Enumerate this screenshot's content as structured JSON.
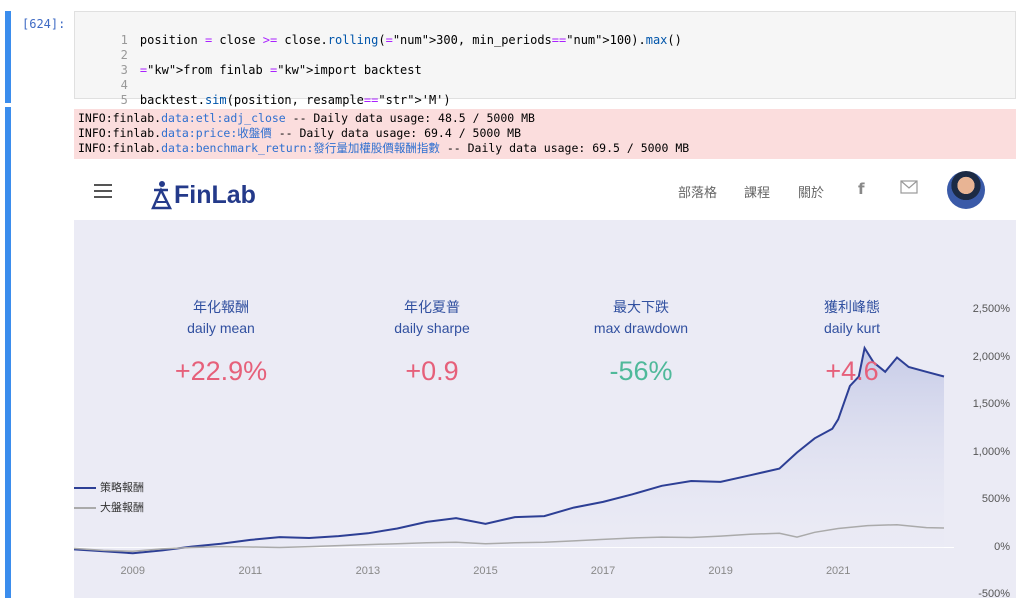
{
  "cell": {
    "prompt": "[624]:",
    "lines": [
      {
        "n": "1",
        "text": "position = close >= close.rolling(300, min_periods=100).max()"
      },
      {
        "n": "2",
        "text": ""
      },
      {
        "n": "3",
        "text": "from finlab import backtest"
      },
      {
        "n": "4",
        "text": ""
      },
      {
        "n": "5",
        "text": "backtest.sim(position, resample='M')"
      }
    ]
  },
  "output": {
    "info_lines": [
      {
        "prefix": "INFO:finlab.",
        "module": "data:etl:adj_close",
        "rest": " -- Daily data usage: 48.5 / 5000 MB"
      },
      {
        "prefix": "INFO:finlab.",
        "module": "data:price:收盤價",
        "rest": " -- Daily data usage: 69.4 / 5000 MB"
      },
      {
        "prefix": "INFO:finlab.",
        "module": "data:benchmark_return:發行量加權股價報酬指數",
        "rest": " -- Daily data usage: 69.5 / 5000 MB"
      }
    ]
  },
  "report": {
    "logo_text": "FinLab",
    "nav": {
      "blog": "部落格",
      "courses": "課程",
      "about": "關於"
    },
    "stats": [
      {
        "title": "年化報酬",
        "sub": "daily mean",
        "value": "+22.9%",
        "color": "#e6607a"
      },
      {
        "title": "年化夏普",
        "sub": "daily sharpe",
        "value": "+0.9",
        "color": "#e6607a"
      },
      {
        "title": "最大下跌",
        "sub": "max drawdown",
        "value": "-56%",
        "color": "#4fb99a"
      },
      {
        "title": "獲利峰態",
        "sub": "daily kurt",
        "value": "+4.6",
        "color": "#e6607a"
      }
    ],
    "legend": {
      "strategy": "策略報酬",
      "benchmark": "大盤報酬"
    }
  },
  "chart_data": {
    "type": "area",
    "x_ticks": [
      "2009",
      "2011",
      "2013",
      "2015",
      "2017",
      "2019",
      "2021"
    ],
    "y_ticks": [
      "2,500%",
      "2,000%",
      "1,500%",
      "1,000%",
      "500%",
      "0%",
      "-500%"
    ],
    "ylim": [
      -500,
      2500
    ],
    "xlim": [
      2008.0,
      2022.8
    ],
    "series": [
      {
        "name": "策略報酬",
        "color": "#2d3f95",
        "points": [
          [
            2008.0,
            -20
          ],
          [
            2008.5,
            -40
          ],
          [
            2009.0,
            -60
          ],
          [
            2009.5,
            -30
          ],
          [
            2010.0,
            10
          ],
          [
            2010.5,
            40
          ],
          [
            2011.0,
            80
          ],
          [
            2011.5,
            110
          ],
          [
            2012.0,
            100
          ],
          [
            2012.5,
            120
          ],
          [
            2013.0,
            150
          ],
          [
            2013.5,
            200
          ],
          [
            2014.0,
            270
          ],
          [
            2014.5,
            310
          ],
          [
            2015.0,
            250
          ],
          [
            2015.5,
            320
          ],
          [
            2016.0,
            330
          ],
          [
            2016.5,
            420
          ],
          [
            2017.0,
            480
          ],
          [
            2017.5,
            560
          ],
          [
            2018.0,
            650
          ],
          [
            2018.5,
            700
          ],
          [
            2019.0,
            690
          ],
          [
            2019.5,
            760
          ],
          [
            2020.0,
            830
          ],
          [
            2020.3,
            1000
          ],
          [
            2020.6,
            1150
          ],
          [
            2020.9,
            1250
          ],
          [
            2021.0,
            1350
          ],
          [
            2021.2,
            1700
          ],
          [
            2021.35,
            1800
          ],
          [
            2021.45,
            2100
          ],
          [
            2021.6,
            1950
          ],
          [
            2021.8,
            1850
          ],
          [
            2022.0,
            2000
          ],
          [
            2022.2,
            1900
          ],
          [
            2022.5,
            1850
          ],
          [
            2022.8,
            1800
          ]
        ]
      },
      {
        "name": "大盤報酬",
        "color": "#aaaaaa",
        "points": [
          [
            2008.0,
            -10
          ],
          [
            2008.5,
            -30
          ],
          [
            2009.0,
            -40
          ],
          [
            2009.5,
            -15
          ],
          [
            2010.0,
            0
          ],
          [
            2010.5,
            10
          ],
          [
            2011.0,
            5
          ],
          [
            2011.5,
            0
          ],
          [
            2012.0,
            10
          ],
          [
            2012.5,
            20
          ],
          [
            2013.0,
            30
          ],
          [
            2013.5,
            40
          ],
          [
            2014.0,
            50
          ],
          [
            2014.5,
            55
          ],
          [
            2015.0,
            40
          ],
          [
            2015.5,
            50
          ],
          [
            2016.0,
            55
          ],
          [
            2016.5,
            70
          ],
          [
            2017.0,
            85
          ],
          [
            2017.5,
            100
          ],
          [
            2018.0,
            110
          ],
          [
            2018.5,
            105
          ],
          [
            2019.0,
            120
          ],
          [
            2019.5,
            140
          ],
          [
            2020.0,
            150
          ],
          [
            2020.3,
            110
          ],
          [
            2020.6,
            160
          ],
          [
            2021.0,
            200
          ],
          [
            2021.5,
            230
          ],
          [
            2022.0,
            240
          ],
          [
            2022.5,
            210
          ],
          [
            2022.8,
            205
          ]
        ]
      }
    ]
  }
}
